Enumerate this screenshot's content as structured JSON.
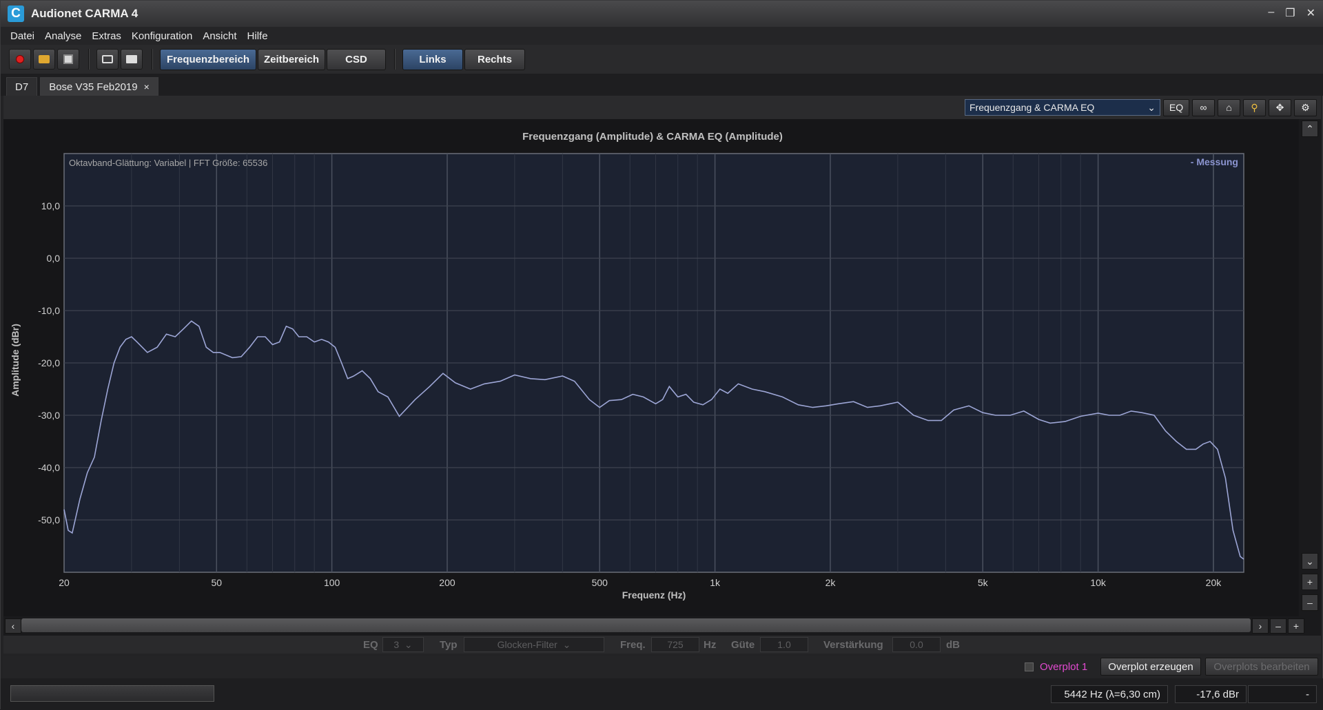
{
  "app": {
    "title": "Audionet CARMA 4",
    "icon_letter": "C"
  },
  "menu": [
    "Datei",
    "Analyse",
    "Extras",
    "Konfiguration",
    "Ansicht",
    "Hilfe"
  ],
  "toolbar": {
    "icons": [
      "record-icon",
      "open-folder-icon",
      "save-icon",
      "screenshot-icon",
      "print-icon"
    ],
    "view_buttons": [
      {
        "label": "Frequenzbereich",
        "active": true
      },
      {
        "label": "Zeitbereich",
        "active": false
      },
      {
        "label": "CSD",
        "active": false
      }
    ],
    "channel_buttons": [
      {
        "label": "Links",
        "active": true
      },
      {
        "label": "Rechts",
        "active": false
      }
    ]
  },
  "tabs": [
    {
      "label": "D7",
      "active": false
    },
    {
      "label": "Bose V35 Feb2019",
      "active": true,
      "close": "×"
    }
  ],
  "chart_tools": {
    "view_select": "Frequenzgang & CARMA EQ",
    "eq_label": "EQ",
    "icons": [
      "link-icon",
      "home-icon",
      "zoom-icon",
      "pan-icon",
      "gear-icon"
    ]
  },
  "chart_data": {
    "type": "line",
    "title": "Frequenzgang (Amplitude) & CARMA EQ (Amplitude)",
    "subtitle": "Oktavband-Glättung: Variabel | FFT Größe: 65536",
    "xlabel": "Frequenz (Hz)",
    "ylabel": "Amplitude (dBr)",
    "xscale": "log",
    "xlim": [
      20,
      24000
    ],
    "ylim": [
      -60,
      20
    ],
    "x_ticks": [
      20,
      50,
      100,
      200,
      500,
      1000,
      2000,
      5000,
      10000,
      20000
    ],
    "x_tick_labels": [
      "20",
      "50",
      "100",
      "200",
      "500",
      "1k",
      "2k",
      "5k",
      "10k",
      "20k"
    ],
    "y_ticks": [
      10,
      0,
      -10,
      -20,
      -30,
      -40,
      -50
    ],
    "y_tick_labels": [
      "10,0",
      "0,0",
      "-10,0",
      "-20,0",
      "-30,0",
      "-40,0",
      "-50,0"
    ],
    "legend": "top-right",
    "grid": true,
    "colors": {
      "plot_bg": "#1c2231",
      "grid": "#3a3f4c",
      "line": "#9da6d6",
      "legend": "#8b94d0",
      "title": "#c0c0c0"
    },
    "series": [
      {
        "name": "Messung",
        "x": [
          20,
          20.5,
          21,
          22,
          23,
          24,
          25,
          26,
          27,
          28,
          29,
          30,
          31,
          33,
          35,
          37,
          39,
          41,
          43,
          45,
          47,
          49,
          51,
          55,
          58,
          61,
          64,
          67,
          70,
          73,
          76,
          79,
          82,
          86,
          90,
          94,
          98,
          102,
          106,
          110,
          114,
          120,
          126,
          132,
          140,
          150,
          165,
          180,
          195,
          210,
          230,
          250,
          275,
          300,
          330,
          360,
          400,
          430,
          470,
          500,
          530,
          570,
          610,
          650,
          700,
          730,
          760,
          800,
          840,
          880,
          930,
          980,
          1030,
          1080,
          1150,
          1250,
          1350,
          1500,
          1650,
          1800,
          1950,
          2100,
          2300,
          2500,
          2700,
          3000,
          3300,
          3600,
          3900,
          4200,
          4600,
          5000,
          5400,
          5900,
          6400,
          7000,
          7500,
          8200,
          9000,
          10000,
          10700,
          11400,
          12200,
          13000,
          14000,
          15000,
          16000,
          17000,
          18000,
          18800,
          19600,
          20500,
          21500,
          22500,
          23500,
          24000
        ],
        "y": [
          -48,
          -52,
          -52.5,
          -46,
          -41,
          -38,
          -31,
          -25,
          -20,
          -17,
          -15.5,
          -15,
          -16,
          -18,
          -17,
          -14.5,
          -15,
          -13.5,
          -12,
          -13,
          -17,
          -18,
          -18,
          -19,
          -18.8,
          -17,
          -15,
          -15,
          -16.5,
          -16,
          -13,
          -13.5,
          -15,
          -15,
          -16,
          -15.5,
          -16,
          -17,
          -20,
          -23,
          -22.5,
          -21.5,
          -23,
          -25.5,
          -26.5,
          -30.2,
          -27,
          -24.5,
          -22,
          -23.8,
          -25,
          -24,
          -23.5,
          -22.3,
          -23,
          -23.2,
          -22.5,
          -23.5,
          -27,
          -28.5,
          -27.2,
          -27,
          -26,
          -26.5,
          -27.8,
          -27,
          -24.5,
          -26.5,
          -26,
          -27.5,
          -28,
          -27,
          -25,
          -25.8,
          -24,
          -25,
          -25.5,
          -26.5,
          -28,
          -28.5,
          -28.2,
          -27.8,
          -27.4,
          -28.5,
          -28.2,
          -27.5,
          -30,
          -31,
          -31,
          -29,
          -28.2,
          -29.5,
          -30,
          -30,
          -29.2,
          -30.8,
          -31.5,
          -31.2,
          -30.2,
          -29.6,
          -30,
          -30,
          -29.2,
          -29.5,
          -30,
          -33,
          -35,
          -36.5,
          -36.5,
          -35.5,
          -35,
          -36.5,
          -42,
          -52,
          -57,
          -57.5
        ]
      }
    ]
  },
  "eq_row": {
    "eq_label": "EQ",
    "eq_value": "3",
    "typ_label": "Typ",
    "typ_value": "Glocken-Filter",
    "freq_label": "Freq.",
    "freq_value": "725",
    "freq_unit": "Hz",
    "guete_label": "Güte",
    "guete_value": "1.0",
    "gain_label": "Verstärkung",
    "gain_value": "0.0",
    "gain_unit": "dB"
  },
  "overplot": {
    "label": "Overplot 1",
    "create_label": "Overplot erzeugen",
    "edit_label": "Overplots bearbeiten"
  },
  "status": {
    "frequency": "5442 Hz (λ=6,30 cm)",
    "level": "-17,6 dBr",
    "extra": "-"
  }
}
